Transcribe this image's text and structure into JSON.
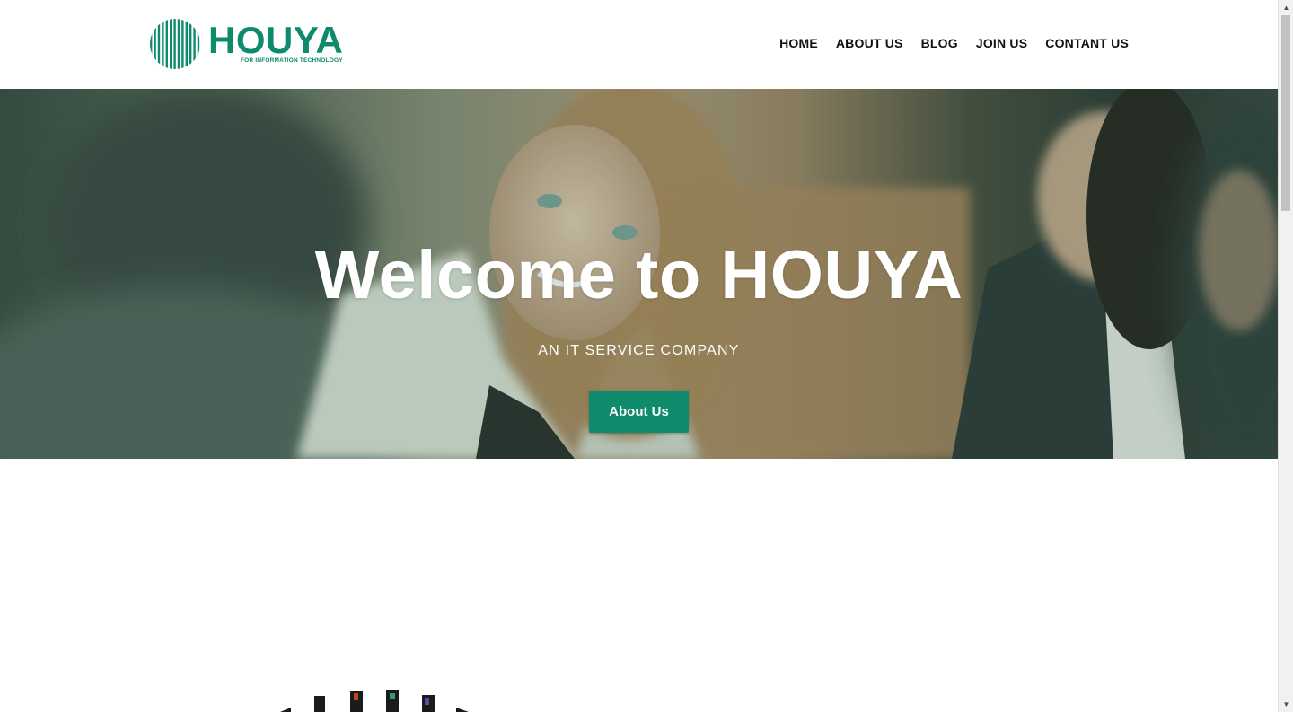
{
  "brand": {
    "name": "HOUYA",
    "tagline": "FOR INFORMATION TECHNOLOGY",
    "color": "#0e8a6c"
  },
  "nav": {
    "items": [
      {
        "label": "HOME"
      },
      {
        "label": "ABOUT US"
      },
      {
        "label": "BLOG"
      },
      {
        "label": "JOIN US"
      },
      {
        "label": "CONTANT US"
      }
    ]
  },
  "hero": {
    "title": "Welcome to HOUYA",
    "subtitle": "AN IT SERVICE COMPANY",
    "button_label": "About Us",
    "button_color": "#0e8a6c"
  },
  "icons": {
    "logo": "striped-globe-icon",
    "scroll_up": "triangle-up-icon",
    "scroll_down": "triangle-down-icon"
  }
}
